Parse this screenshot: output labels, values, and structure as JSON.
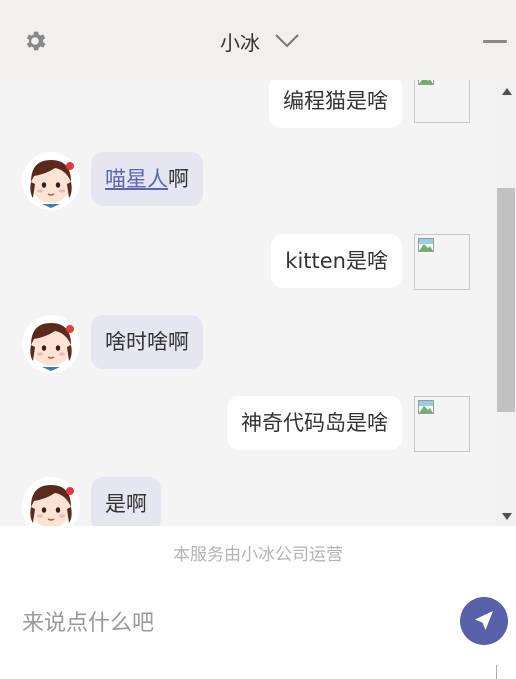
{
  "header": {
    "title": "小冰",
    "settings_icon": "gear-icon",
    "dropdown_icon": "chevron-down-icon",
    "minimize_icon": "minimize-icon"
  },
  "messages": [
    {
      "from": "user",
      "text": "编程猫是啥",
      "attachment": "broken-image-icon"
    },
    {
      "from": "bot",
      "link": "喵星人",
      "text": "啊"
    },
    {
      "from": "user",
      "text": "kitten是啥",
      "attachment": "broken-image-icon"
    },
    {
      "from": "bot",
      "text": "啥时啥啊"
    },
    {
      "from": "user",
      "text": "神奇代码岛是啥",
      "attachment": "broken-image-icon"
    },
    {
      "from": "bot",
      "text": "是啊"
    }
  ],
  "footer": {
    "note": "本服务由小冰公司运营"
  },
  "composer": {
    "placeholder": "来说点什么吧",
    "value": "",
    "send_icon": "send-icon"
  },
  "colors": {
    "accent": "#5860a8",
    "bot_bubble": "#e6e6f0",
    "header_bg": "#f1f0ee",
    "chat_bg": "#f4f4f4"
  }
}
